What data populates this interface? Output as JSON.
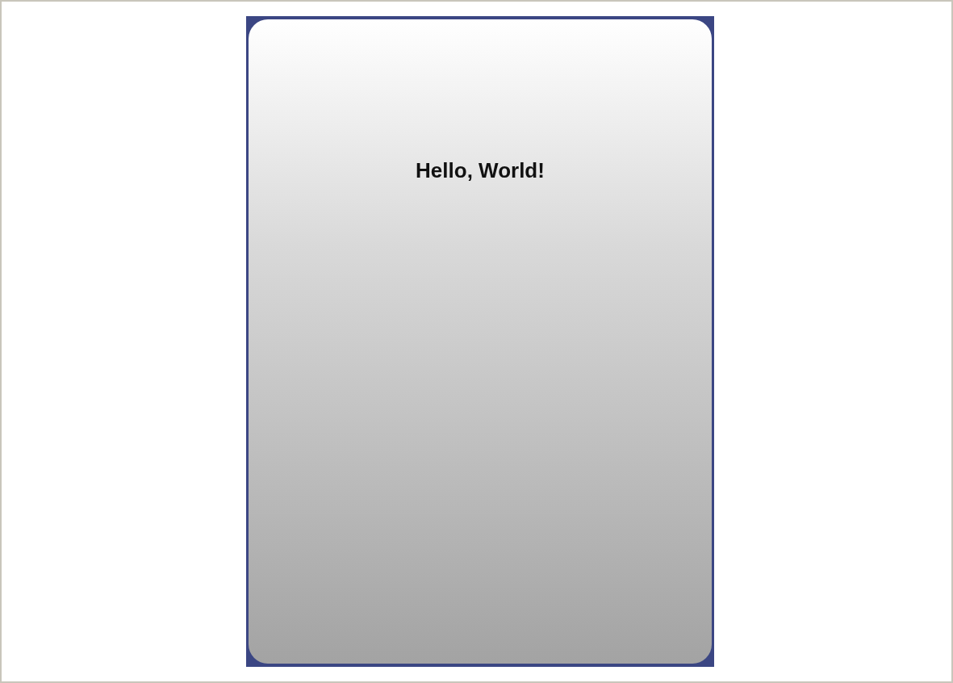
{
  "screen": {
    "message": "Hello, World!"
  }
}
